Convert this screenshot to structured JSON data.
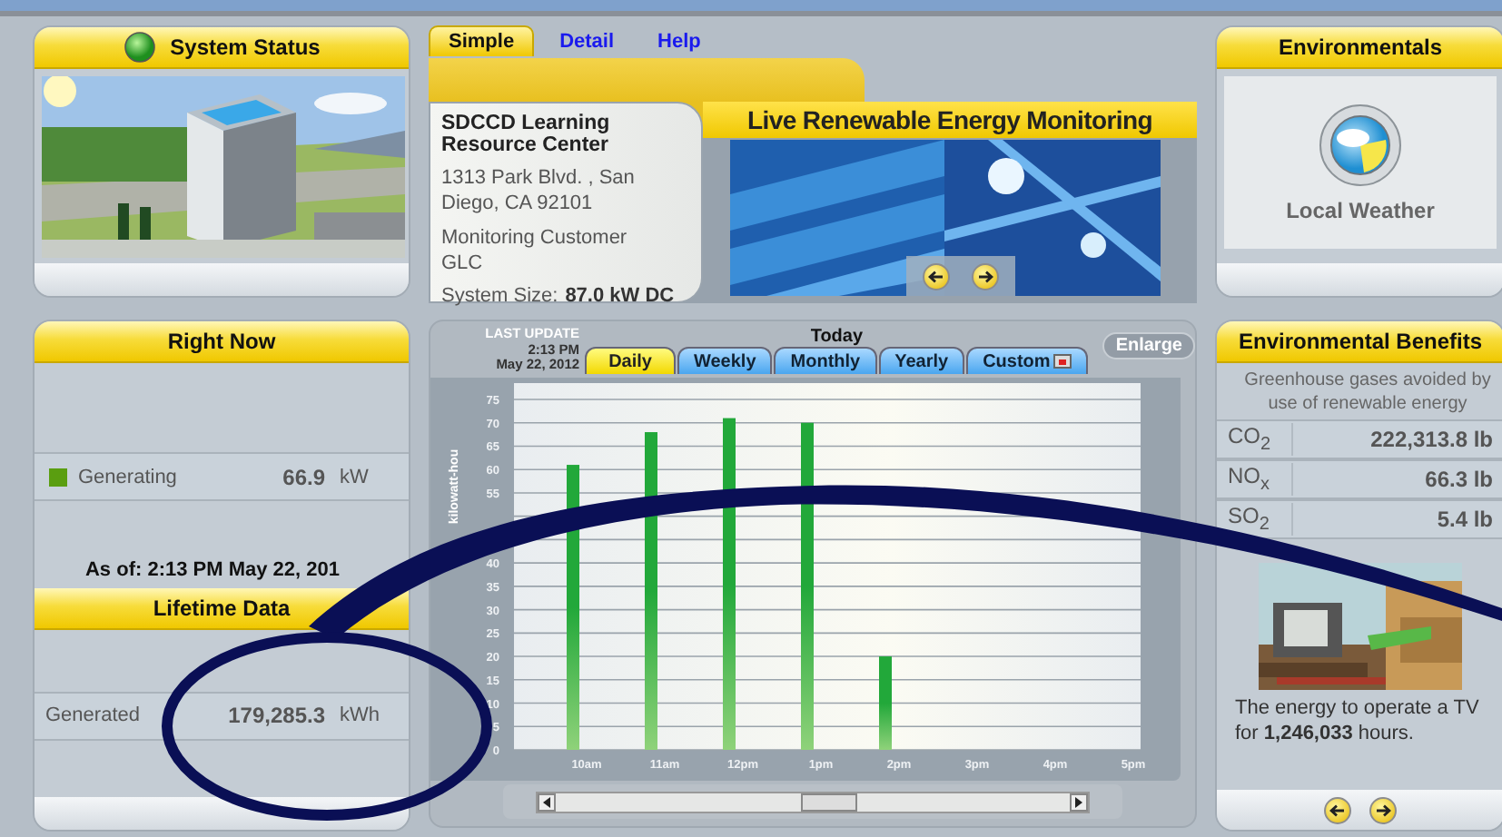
{
  "nav_tabs": [
    {
      "label": "Simple",
      "selected": true
    },
    {
      "label": "Detail",
      "selected": false
    },
    {
      "label": "Help",
      "selected": false
    }
  ],
  "system_status": {
    "title": "System Status"
  },
  "right_now": {
    "title": "Right Now",
    "rows": [
      {
        "label": "Generating",
        "value": "66.9",
        "unit": "kW"
      }
    ],
    "as_of": "As of: 2:13 PM May 22, 201"
  },
  "lifetime": {
    "title": "Lifetime Data",
    "rows": [
      {
        "label": "Generated",
        "value": "179,285.3",
        "unit": "kWh"
      }
    ]
  },
  "site": {
    "name": "SDCCD Learning Resource Center",
    "address": "1313 Park Blvd. , San Diego, CA 92101",
    "customer_type": "Monitoring Customer",
    "customer": "GLC",
    "size_label": "System Size:",
    "size": "87.0 kW DC"
  },
  "banner": "Live Renewable Energy Monitoring",
  "chart_panel": {
    "last_update_label": "LAST UPDATE",
    "last_update_time": "2:13 PM",
    "last_update_date": "May 22, 2012",
    "title": "Today",
    "tabs": [
      {
        "label": "Daily",
        "selected": true
      },
      {
        "label": "Weekly",
        "selected": false
      },
      {
        "label": "Monthly",
        "selected": false
      },
      {
        "label": "Yearly",
        "selected": false
      },
      {
        "label": "Custom",
        "selected": false,
        "kind": "calendar"
      }
    ],
    "enlarge": "Enlarge",
    "chart_data": {
      "type": "bar",
      "ylabel": "kilowatt-hou",
      "categories": [
        "10am",
        "11am",
        "12pm",
        "1pm",
        "2pm",
        "3pm",
        "4pm",
        "5pm"
      ],
      "series": [
        {
          "color": "#22a83a",
          "values": [
            61,
            68,
            71,
            70,
            20,
            null,
            null,
            null
          ]
        }
      ],
      "ylim": [
        0,
        75
      ],
      "yticks": [
        0,
        5,
        10,
        15,
        20,
        25,
        30,
        35,
        40,
        55,
        60,
        65,
        70,
        75
      ],
      "grid": true
    }
  },
  "environmentals": {
    "title": "Environmentals",
    "weather_label": "Local Weather"
  },
  "benefits": {
    "title": "Environmental Benefits",
    "description": "Greenhouse gases avoided by use of renewable energy",
    "rows": [
      {
        "gas": "CO$_{2}$",
        "amount": "222,313.8 lb"
      },
      {
        "gas": "NO$_{x}$",
        "amount": "66.3 lb"
      },
      {
        "gas": "SO$_{2}$",
        "amount": "5.4 lb"
      }
    ],
    "equivalent": "The energy to operate a TV for **1,246,033** hours."
  }
}
